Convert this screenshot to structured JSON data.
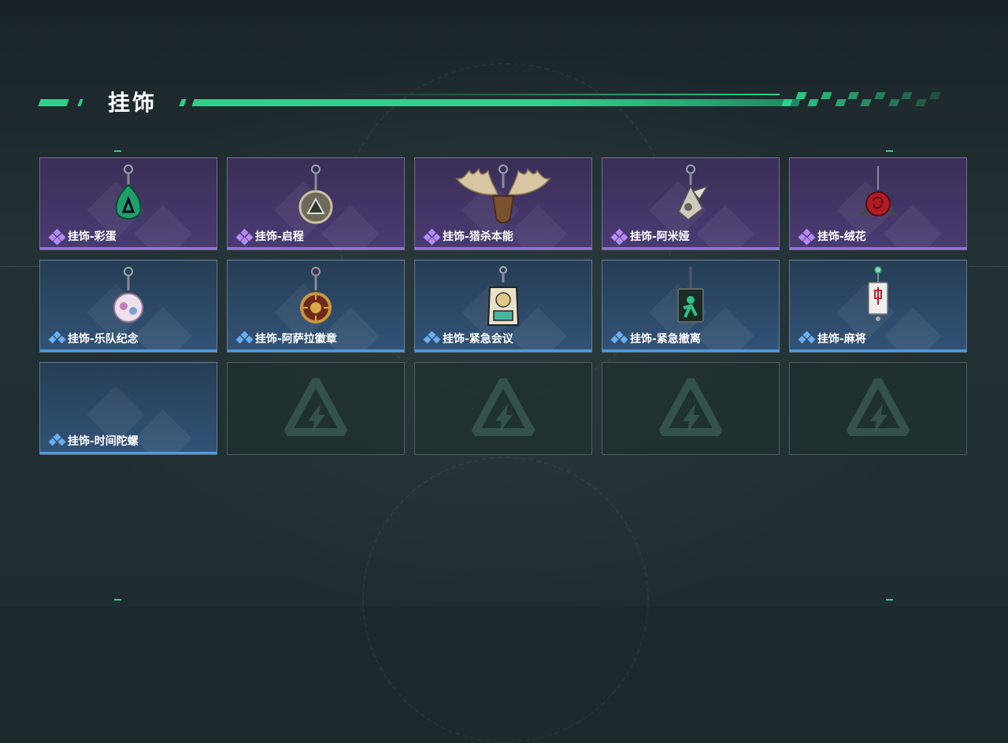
{
  "header": {
    "title": "挂饰"
  },
  "colors": {
    "accent": "#2fd08a",
    "epic": "#9a6fe0",
    "rare": "#4f9be0"
  },
  "items": [
    {
      "label": "挂饰-彩蛋",
      "rarity": "epic",
      "icon": "green-teardrop-charm-icon"
    },
    {
      "label": "挂饰-启程",
      "rarity": "epic",
      "icon": "round-medallion-charm-icon"
    },
    {
      "label": "挂饰-猎杀本能",
      "rarity": "epic",
      "icon": "moose-antler-charm-icon"
    },
    {
      "label": "挂饰-阿米娅",
      "rarity": "epic",
      "icon": "bunny-doll-charm-icon"
    },
    {
      "label": "挂饰-绒花",
      "rarity": "epic",
      "icon": "red-rose-charm-icon"
    },
    {
      "label": "挂饰-乐队纪念",
      "rarity": "rare",
      "icon": "band-badge-charm-icon"
    },
    {
      "label": "挂饰-阿萨拉徽章",
      "rarity": "rare",
      "icon": "sun-emblem-charm-icon"
    },
    {
      "label": "挂饰-紧急会议",
      "rarity": "rare",
      "icon": "meeting-figure-charm-icon"
    },
    {
      "label": "挂饰-紧急撤离",
      "rarity": "rare",
      "icon": "green-sign-charm-icon"
    },
    {
      "label": "挂饰-麻将",
      "rarity": "rare",
      "icon": "mahjong-tile-charm-icon"
    },
    {
      "label": "挂饰-时间陀螺",
      "rarity": "rare",
      "icon": "spinning-top-charm-icon"
    },
    {
      "label": "",
      "rarity": "empty",
      "icon": "empty-slot-logo-icon"
    },
    {
      "label": "",
      "rarity": "empty",
      "icon": "empty-slot-logo-icon"
    },
    {
      "label": "",
      "rarity": "empty",
      "icon": "empty-slot-logo-icon"
    },
    {
      "label": "",
      "rarity": "empty",
      "icon": "empty-slot-logo-icon"
    }
  ]
}
